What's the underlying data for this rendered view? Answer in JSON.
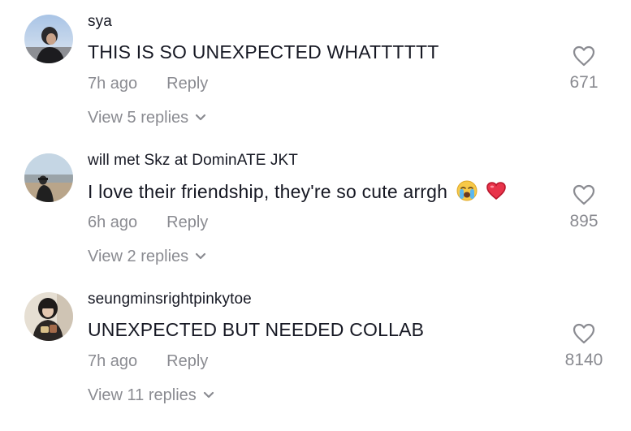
{
  "comments": [
    {
      "username": "sya",
      "text": "THIS IS SO UNEXPECTED WHATTTTTT",
      "time": "7h ago",
      "reply_label": "Reply",
      "likes": "671",
      "view_replies": "View 5 replies"
    },
    {
      "username": "will met Skz at DominATE JKT",
      "text": "I love their friendship, they're so cute arrgh",
      "emojis": [
        "crying-face",
        "red-heart"
      ],
      "time": "6h ago",
      "reply_label": "Reply",
      "likes": "895",
      "view_replies": "View 2 replies"
    },
    {
      "username": "seungminsrightpinkytoe",
      "text": "UNEXPECTED BUT NEEDED COLLAB",
      "time": "7h ago",
      "reply_label": "Reply",
      "likes": "8140",
      "view_replies": "View 11 replies"
    }
  ],
  "colors": {
    "primary_text": "#161823",
    "secondary_text": "#8a8b91"
  },
  "icons": [
    "heart-outline-icon",
    "chevron-down-icon"
  ]
}
